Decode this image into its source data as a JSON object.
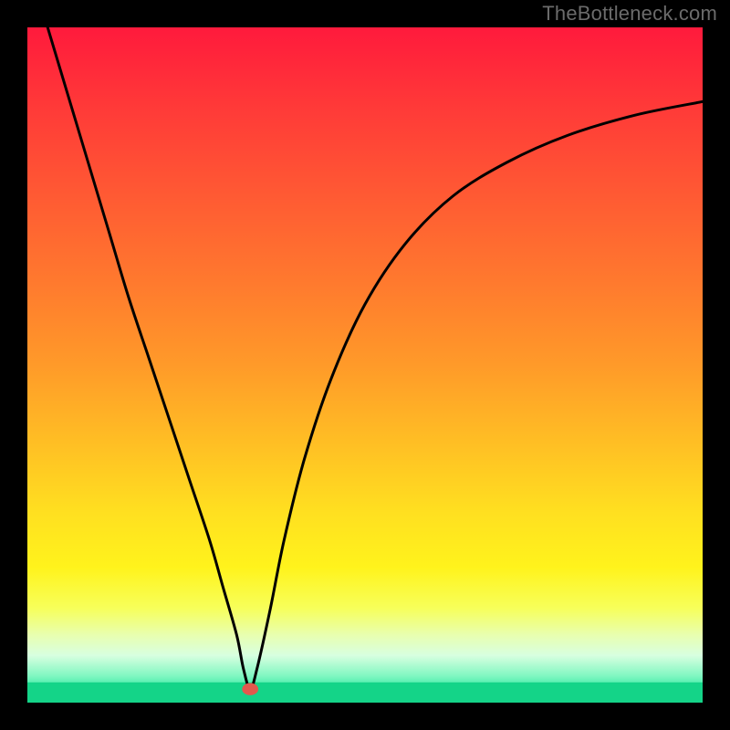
{
  "watermark": "TheBottleneck.com",
  "chart_data": {
    "type": "line",
    "title": "",
    "xlabel": "",
    "ylabel": "",
    "xlim": [
      0,
      100
    ],
    "ylim": [
      0,
      100
    ],
    "grid": false,
    "background": "heatmap-gradient",
    "green_band_y_range": [
      0,
      3
    ],
    "marker": {
      "x": 33,
      "y": 2,
      "color": "#e2594d",
      "radius_pct": 1.2
    },
    "series": [
      {
        "name": "bottleneck-curve",
        "color": "#000000",
        "x": [
          3,
          6,
          9,
          12,
          15,
          18,
          21,
          24,
          27,
          29,
          31,
          32,
          33,
          34,
          36,
          38,
          41,
          45,
          50,
          56,
          63,
          71,
          80,
          90,
          100
        ],
        "values": [
          100,
          90,
          80,
          70,
          60,
          51,
          42,
          33,
          24,
          17,
          10,
          5,
          2,
          5,
          14,
          24,
          36,
          48,
          59,
          68,
          75,
          80,
          84,
          87,
          89
        ]
      }
    ],
    "gradient_stops": [
      {
        "offset": 0.0,
        "color": "#ff1a3c"
      },
      {
        "offset": 0.12,
        "color": "#ff3a38"
      },
      {
        "offset": 0.25,
        "color": "#ff5a33"
      },
      {
        "offset": 0.38,
        "color": "#ff7a2e"
      },
      {
        "offset": 0.5,
        "color": "#ff9a29"
      },
      {
        "offset": 0.62,
        "color": "#ffc024"
      },
      {
        "offset": 0.72,
        "color": "#ffe020"
      },
      {
        "offset": 0.8,
        "color": "#fff31c"
      },
      {
        "offset": 0.86,
        "color": "#f7ff5a"
      },
      {
        "offset": 0.9,
        "color": "#e8ffb0"
      },
      {
        "offset": 0.93,
        "color": "#d8ffe0"
      },
      {
        "offset": 0.96,
        "color": "#82f7c2"
      },
      {
        "offset": 0.985,
        "color": "#22e59a"
      },
      {
        "offset": 1.0,
        "color": "#14d488"
      }
    ]
  }
}
